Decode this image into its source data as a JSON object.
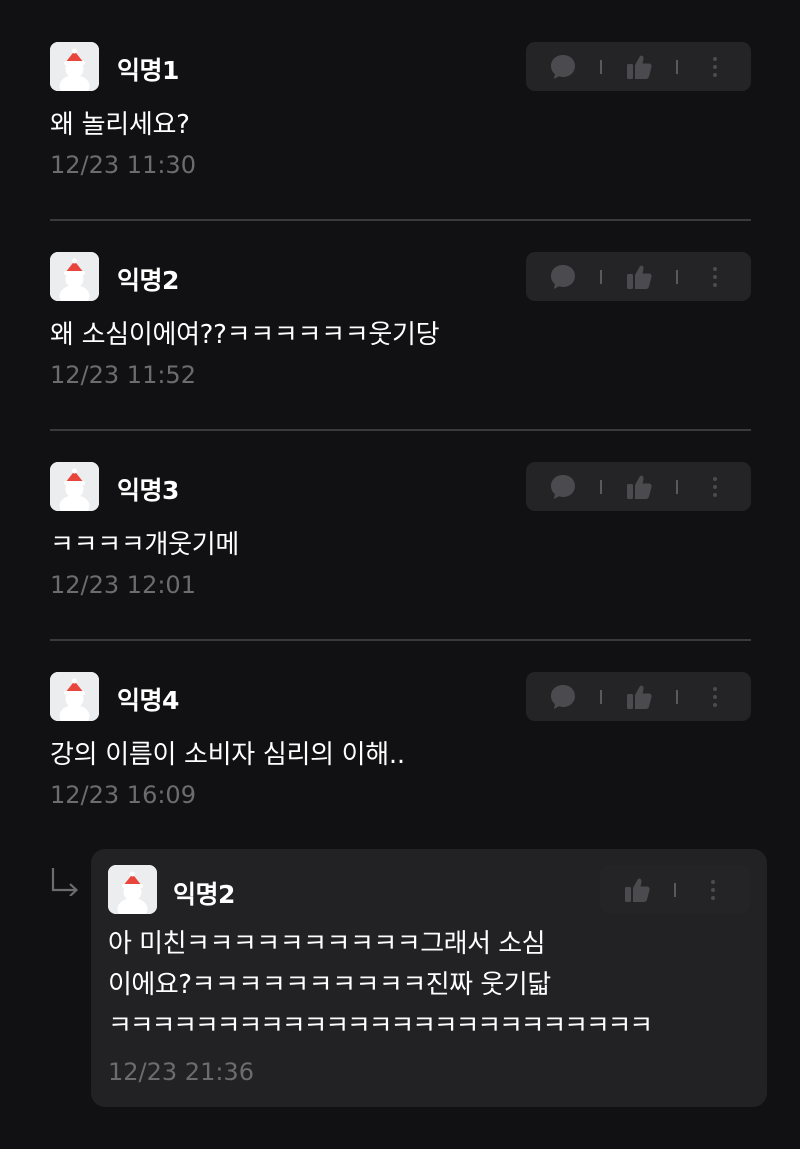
{
  "comments": [
    {
      "nickname": "익명1",
      "text": "왜 놀리세요?",
      "time": "12/23 11:30"
    },
    {
      "nickname": "익명2",
      "text": "왜 소심이에여??ㅋㅋㅋㅋㅋㅋ웃기당",
      "time": "12/23 11:52"
    },
    {
      "nickname": "익명3",
      "text": "ㅋㅋㅋㅋ개웃기메",
      "time": "12/23 12:01"
    },
    {
      "nickname": "익명4",
      "text": "강의 이름이 소비자 심리의 이해..",
      "time": "12/23 16:09"
    }
  ],
  "reply": {
    "nickname": "익명2",
    "lines": [
      "아 미친ㅋㅋㅋㅋㅋㅋㅋㅋㅋㅋ그래서 소심",
      "이에요?ㅋㅋㅋㅋㅋㅋㅋㅋㅋㅋ진짜 웃기닯",
      "ㅋㅋㅋㅋㅋㅋㅋㅋㅋㅋㅋㅋㅋㅋㅋㅋㅋㅋㅋㅋㅋㅋㅋㅋㅋ"
    ],
    "time": "12/23 21:36"
  },
  "icons": {
    "comment": "speech-bubble-icon",
    "like": "thumbs-up-icon",
    "more": "vertical-dots-icon",
    "reply_arrow": "reply-arrow-icon",
    "avatar": "santa-avatar-icon"
  },
  "colors": {
    "background": "#111012",
    "card": "#222124",
    "action_bar": "#242326",
    "icon": "#4b4a4e",
    "timestamp": "#6c6b70",
    "divider": "#3a393c"
  }
}
